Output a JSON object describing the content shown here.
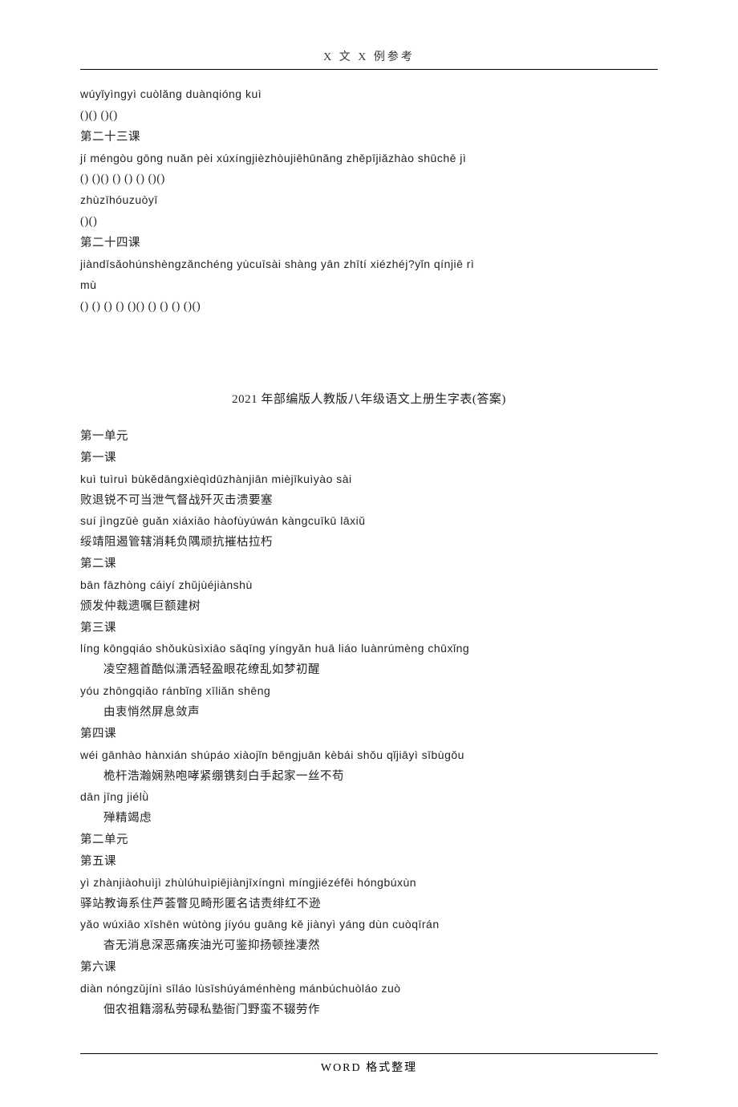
{
  "header": "X 文 X 例参考",
  "footer": "WORD 格式整理",
  "top": {
    "l1": "wúyǐyìngyì cuòlǎng duànqióng kuì",
    "l2": "()() ()()",
    "l3": "第二十三课",
    "l4": "jí méngòu gōng nuǎn pèi xúxíngjièzhòujiēhūnǎng zhěpījiǎzhào shūchē jì",
    "l5": "() ()() () () () ()()",
    "l6": "zhùzīhóuzuòyī",
    "l7": "()()",
    "l8": "第二十四课",
    "l9": "jiàndīsǎohúnshèngzǎnchéng yùcuīsài shàng yān zhītí xiézhéj?yǐn qínjiē rì",
    "l10": "mù",
    "l11": "() () () () ()() () () () ()()"
  },
  "title": "2021 年部编版人教版八年级语文上册生字表(答案)",
  "body": {
    "u1": "第一单元",
    "c1": "第一课",
    "c1p1": "kuì tuìruì bùkědāngxièqìdūzhànjiān mièjīkuìyào sài",
    "c1z1": "败退锐不可当泄气督战歼灭击溃要塞",
    "c1p2": "suí jìngzǔè guǎn xiáxiāo hàofùyúwán kàngcuīkū lāxiǔ",
    "c1z2": "绥靖阻遏管辖消耗负隅顽抗摧枯拉朽",
    "c2": "第二课",
    "c2p1": "bān fāzhòng cáiyí zhǔjùéjiànshù",
    "c2z1": "颁发仲裁遗嘱巨额建树",
    "c3": "第三课",
    "c3p1": "líng kōngqiáo shǒukùsìxiāo sǎqīng yíngyǎn huā liáo luànrúmèng chūxǐng",
    "c3z1": "凌空翘首酷似潇洒轻盈眼花缭乱如梦初醒",
    "c3p2": "yóu zhōngqiǎo ránbǐng xīliǎn shēng",
    "c3z2": "由衷悄然屏息敛声",
    "c4": "第四课",
    "c4p1": "wéi gānhào hànxián shúpáo xiàojǐn bēngjuān kèbái shǒu qǐjiāyì sībùgǒu",
    "c4z1": "桅杆浩瀚娴熟咆哮紧绷镌刻白手起家一丝不苟",
    "c4p2": "dān jīng jiélǜ",
    "c4z2": "殚精竭虑",
    "u2": "第二单元",
    "c5": "第五课",
    "c5p1": "yì zhànjiàohuìjì zhùlúhuìpiējiànjīxíngnì míngjiézéfēi hóngbúxùn",
    "c5z1": "驿站教诲系住芦荟瞥见畸形匿名诘责绯红不逊",
    "c5p2": "yǎo wúxiāo xīshēn wùtòng jíyóu guāng kě jiànyì yáng dùn cuòqīrán",
    "c5z2": "杳无消息深恶痛疾油光可鉴抑扬顿挫凄然",
    "c6": "第六课",
    "c6p1": "diàn nóngzǔjínì sīláo lùsīshúyáménhèng mánbúchuòláo zuò",
    "c6z1": "佃农祖籍溺私劳碌私塾衙门野蛮不辍劳作"
  }
}
